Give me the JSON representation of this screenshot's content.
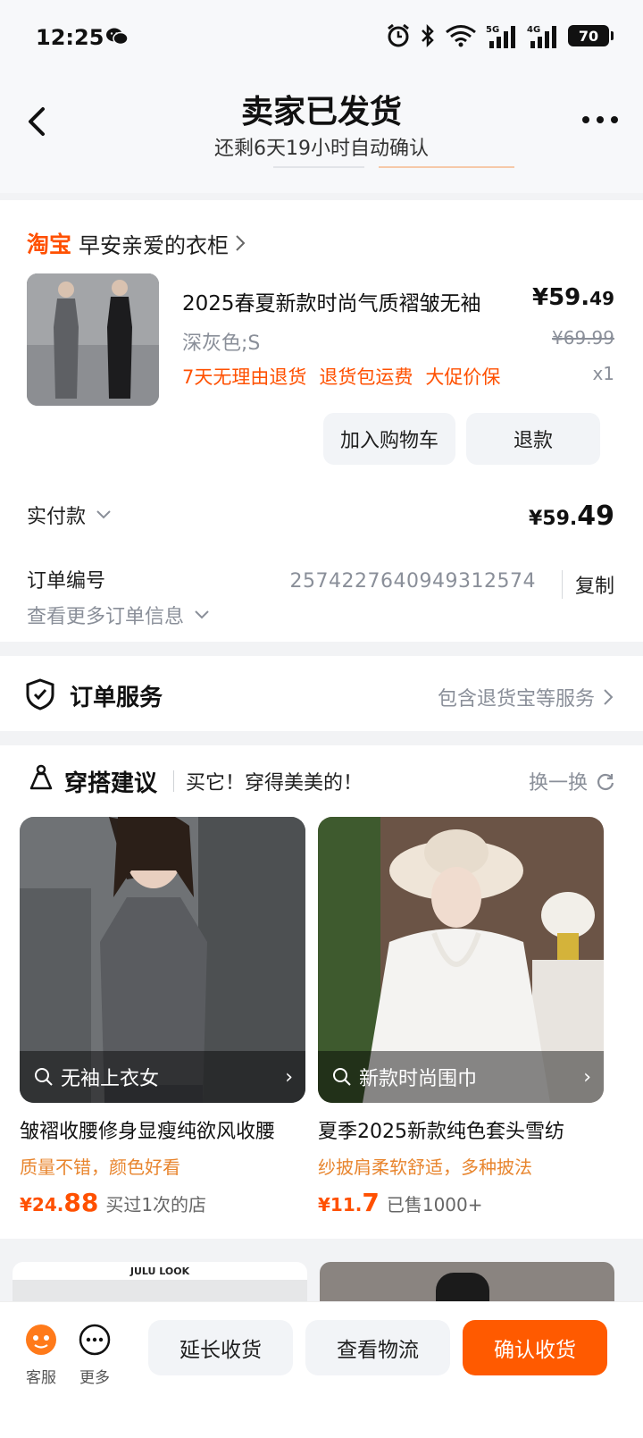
{
  "status_bar": {
    "time": "12:25",
    "battery": "70",
    "icons": [
      "wechat-icon",
      "alarm-icon",
      "bluetooth-icon",
      "wifi-icon",
      "5g-signal-icon",
      "4g-signal-icon",
      "battery-icon"
    ],
    "network_5g": "5G",
    "network_4g": "4G"
  },
  "header": {
    "title": "卖家已发货",
    "subtitle": "还剩6天19小时自动确认"
  },
  "order": {
    "shop_brand": "淘宝",
    "shop_name": "早安亲爱的衣柜",
    "product_title": "2025春夏新款时尚气质褶皱无袖",
    "price_main": "¥59.",
    "price_decimal": "49",
    "sku": "深灰色;S",
    "original_price": "¥69.99",
    "tags": [
      "7天无理由退货",
      "退货包运费",
      "大促价保"
    ],
    "quantity": "x1",
    "add_cart_label": "加入购物车",
    "refund_label": "退款",
    "paid_label": "实付款",
    "paid_main": "¥59.",
    "paid_decimal": "49",
    "order_no_label": "订单编号",
    "order_no": "2574227640949312574",
    "copy_label": "复制",
    "more_info_label": "查看更多订单信息"
  },
  "service": {
    "title": "订单服务",
    "right_text": "包含退货宝等服务"
  },
  "recommend": {
    "title": "穿搭建议",
    "subtitle": "买它！穿得美美的！",
    "refresh_label": "换一换",
    "items": [
      {
        "search_label": "无袖上衣女",
        "name": "皱褶收腰修身显瘦纯欲风收腰",
        "desc": "质量不错，颜色好看",
        "price_main": "¥24.",
        "price_decimal": "88",
        "meta": "买过1次的店"
      },
      {
        "search_label": "新款时尚围巾",
        "name": "夏季2025新款纯色套头雪纺",
        "desc": "纱披肩柔软舒适，多种披法",
        "price_main": "¥11.",
        "price_decimal": "7",
        "meta": "已售1000+"
      }
    ],
    "third_brand": "JULU LOOK"
  },
  "bottom_bar": {
    "service_label": "客服",
    "more_label": "更多",
    "extend_label": "延长收货",
    "logistics_label": "查看物流",
    "confirm_label": "确认收货"
  },
  "colors": {
    "accent": "#ff5000",
    "confirm_button": "#ff5a00",
    "desc_orange": "#e8852e"
  }
}
